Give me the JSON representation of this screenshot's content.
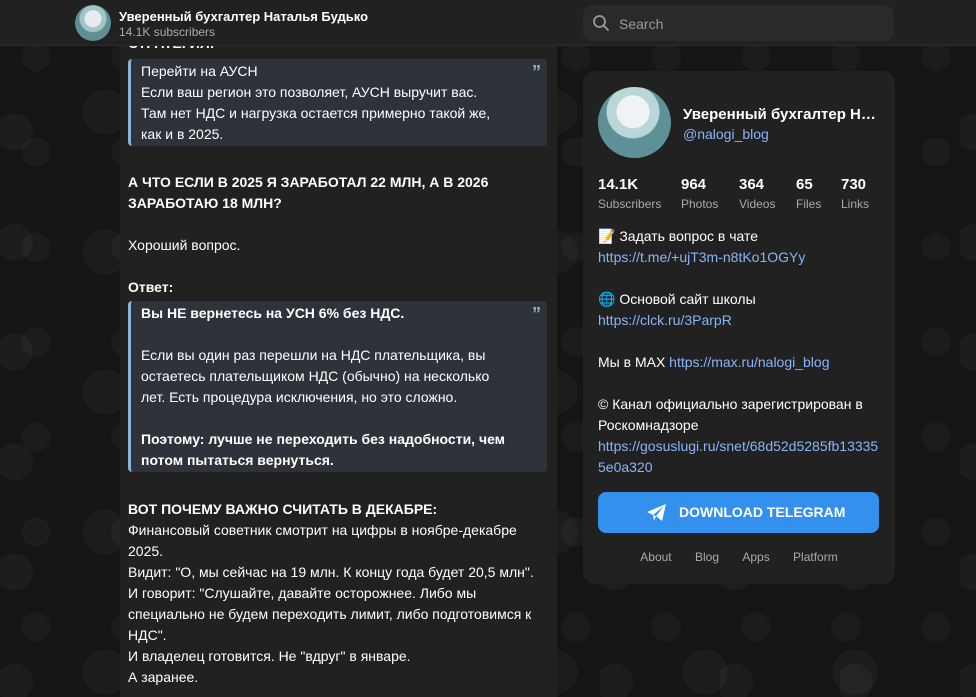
{
  "header": {
    "channel_name": "Уверенный бухгалтер Наталья Будько",
    "subscribers": "14.1K subscribers",
    "search_placeholder": "Search"
  },
  "post": {
    "cut_heading": "СТРАТЕГИЯ:",
    "quote1": {
      "line1": "Перейти на АУСН",
      "line2": "Если ваш регион это позволяет, АУСН выручит вас.",
      "line3": "Там нет НДС и нагрузка остается примерно такой же,",
      "line4": "как и в 2025."
    },
    "question_line1": "А ЧТО ЕСЛИ В 2025 Я ЗАРАБОТАЛ 22 МЛН, А В 2026",
    "question_line2": "ЗАРАБОТАЮ 18 МЛН?",
    "good_question": "Хороший вопрос.",
    "answer_label": "Ответ:",
    "quote2": {
      "line1": "Вы НЕ вернетесь на УСН 6% без НДС.",
      "line2": "Если вы один раз перешли на НДС плательщика, вы",
      "line3": "остаетесь плательщиком НДС (обычно) на несколько",
      "line4": "лет. Есть процедура исключения, но это сложно.",
      "line5": "Поэтому: лучше не переходить без надобности, чем",
      "line6": "потом пытаться вернуться."
    },
    "why_heading": "ВОТ ПОЧЕМУ ВАЖНО СЧИТАТЬ В ДЕКАБРЕ:",
    "p1": "Финансовый советник смотрит на цифры в ноябре-декабре",
    "p2": "2025.",
    "p3": "Видит: \"О, мы сейчас на 19 млн. К концу года будет 20,5 млн\".",
    "p4": "И говорит: \"Слушайте, давайте осторожнее. Либо мы",
    "p5": "специально не будем переходить лимит, либо подготовимся к",
    "p6": "НДС\".",
    "p7": "И владелец готовится. Не \"вдруг\" в январе.",
    "p8": "А заранее."
  },
  "card": {
    "name": "Уверенный бухгалтер Наталья Будько",
    "handle": "@nalogi_blog",
    "stats": [
      {
        "value": "14.1K",
        "label": "Subscribers"
      },
      {
        "value": "964",
        "label": "Photos"
      },
      {
        "value": "364",
        "label": "Videos"
      },
      {
        "value": "65",
        "label": "Files"
      },
      {
        "value": "730",
        "label": "Links"
      }
    ],
    "desc": {
      "chat_text": "📝 Задать вопрос в чате",
      "chat_link": "https://t.me/+ujT3m-n8tKo1OGYy",
      "site_text": "🌐 Основой сайт школы",
      "site_link": "https://clck.ru/3ParpR",
      "max_text": "Мы в MAX",
      "max_link": "https://max.ru/nalogi_blog",
      "reg_text": "© Канал официально зарегистрирован в Роскомнадзоре",
      "reg_link": "https://gosuslugi.ru/snet/68d52d5285fb133355e0a320"
    },
    "download_label": "DOWNLOAD TELEGRAM",
    "footer_links": [
      "About",
      "Blog",
      "Apps",
      "Platform"
    ]
  },
  "colors": {
    "accent": "#3390ec",
    "link": "#8ab4f8",
    "quote_bar": "#8ab4d8"
  }
}
